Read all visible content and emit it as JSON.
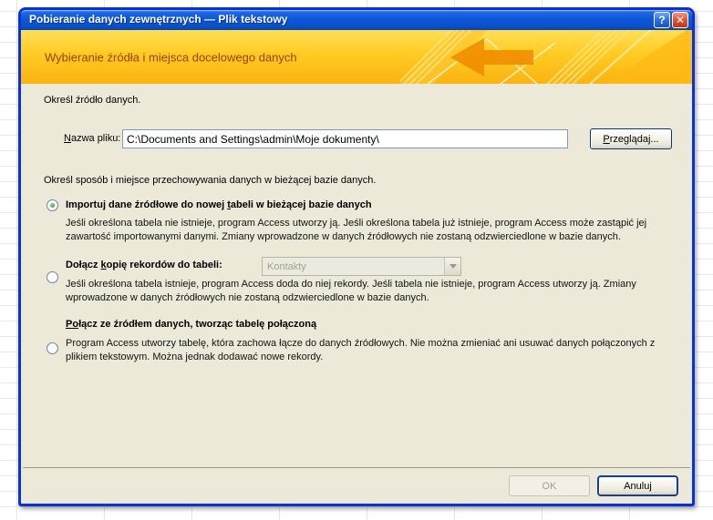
{
  "colors": {
    "titlebar_blue": "#0d57d8",
    "window_border": "#0831d9",
    "header_gold_top": "#ffdf55",
    "header_gold_bottom": "#fbb312",
    "header_text": "#a23c00",
    "dialog_background": "#ece9d8",
    "arrow_accent_orange": "#f08e00",
    "selected_radio_green": "#2f9b2f",
    "disabled_text": "#a09e90",
    "input_border": "#7f9db9"
  },
  "window": {
    "title": "Pobieranie danych zewnętrznych — Plik tekstowy",
    "controls": {
      "help": "?",
      "close": "✕"
    }
  },
  "header": {
    "title": "Wybieranie źródła i miejsca docelowego danych"
  },
  "source_section": {
    "instruction": "Określ źródło danych.",
    "file_label": {
      "pre": "",
      "accel": "N",
      "post": "azwa pliku:"
    },
    "file_path": "C:\\Documents and Settings\\admin\\Moje dokumenty\\",
    "browse_button": {
      "pre": "",
      "accel": "P",
      "post": "rzeglądaj..."
    }
  },
  "destination_section": {
    "instruction": "Określ sposób i miejsce przechowywania danych w bieżącej bazie danych.",
    "options": [
      {
        "selected": true,
        "label": {
          "pre": "Importuj dane źródłowe do nowej ",
          "accel": "t",
          "post": "abeli w bieżącej bazie danych"
        },
        "description": "Jeśli określona tabela nie istnieje, program Access utworzy ją. Jeśli określona tabela już istnieje, program Access może zastąpić jej zawartość importowanymi danymi. Zmiany wprowadzone w danych źródłowych nie zostaną odzwierciedlone w bazie danych."
      },
      {
        "selected": false,
        "label": {
          "pre": "Dołącz ",
          "accel": "k",
          "post": "opię rekordów do tabeli:"
        },
        "combo_value": "Kontakty",
        "description": "Jeśli określona tabela istnieje, program Access doda do niej rekordy. Jeśli tabela nie istnieje, program Access utworzy ją. Zmiany wprowadzone w danych źródłowych nie zostaną odzwierciedlone w bazie danych."
      },
      {
        "selected": false,
        "label": {
          "pre": "",
          "accel": "Po",
          "post": "łącz ze źródłem danych, tworząc tabelę połączoną"
        },
        "description": "Program Access utworzy tabelę, która zachowa łącze do danych źródłowych. Nie można zmieniać ani usuwać danych połączonych z plikiem tekstowym. Można jednak dodawać nowe rekordy."
      }
    ]
  },
  "footer": {
    "ok_label": "OK",
    "cancel_label": "Anuluj"
  }
}
